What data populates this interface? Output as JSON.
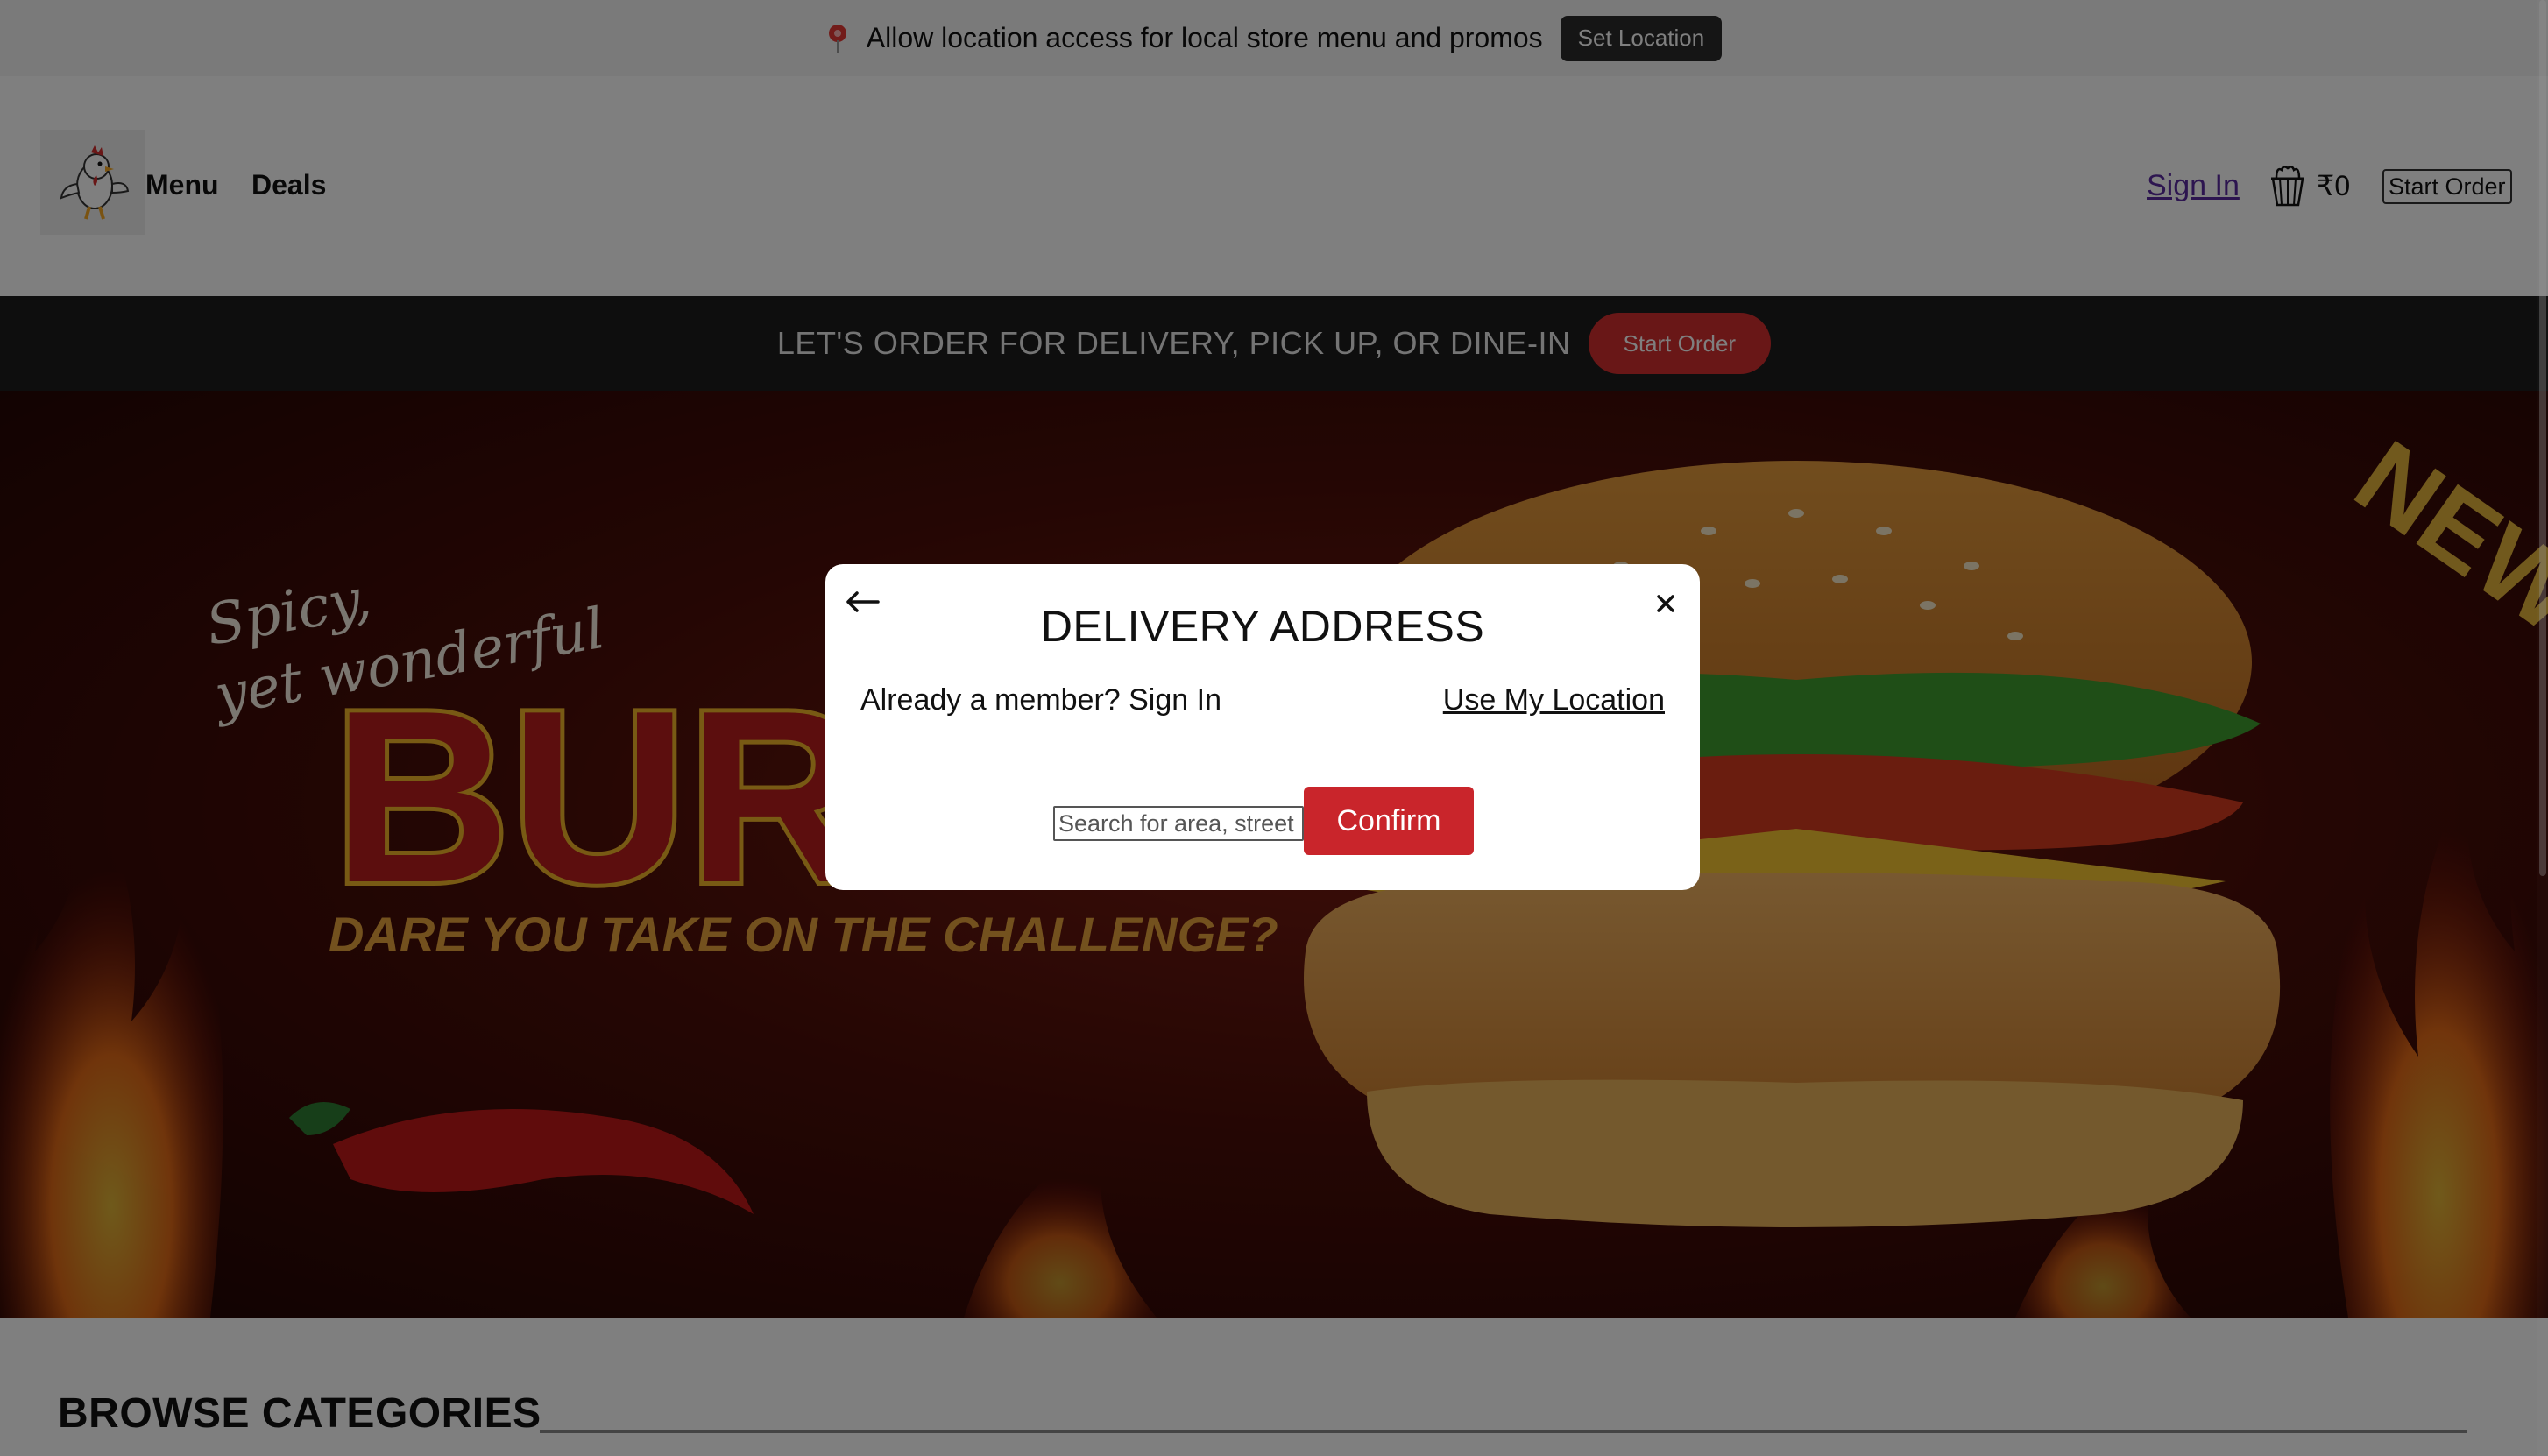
{
  "location_bar": {
    "icon": "map-pin-icon",
    "message": "Allow location access for local store menu and promos",
    "button_label": "Set Location"
  },
  "header": {
    "logo_icon": "chicken-mascot-logo",
    "nav": [
      "Menu",
      "Deals"
    ],
    "sign_in": "Sign In",
    "cart_icon": "bucket-cart-icon",
    "cart_total": "₹0",
    "start_order": "Start Order"
  },
  "order_strip": {
    "text": "LET'S ORDER FOR DELIVERY, PICK UP, OR DINE-IN",
    "button_label": "Start Order",
    "button_color": "#d32f2f"
  },
  "hero": {
    "tagline": "Spicy, yet wonderful",
    "headline": "BURGE",
    "subline": "DARE YOU TAKE ON THE CHALLENGE?",
    "badge": "NEW"
  },
  "browse": {
    "title": "BROWSE CATEGORIES"
  },
  "modal": {
    "title": "DELIVERY ADDRESS",
    "member_text": "Already a member? Sign In",
    "use_location": "Use My Location",
    "search_placeholder": "Search for area, street name",
    "confirm_label": "Confirm",
    "confirm_color": "#c9252b",
    "back_icon": "arrow-left-icon",
    "close_icon": "close-icon"
  }
}
